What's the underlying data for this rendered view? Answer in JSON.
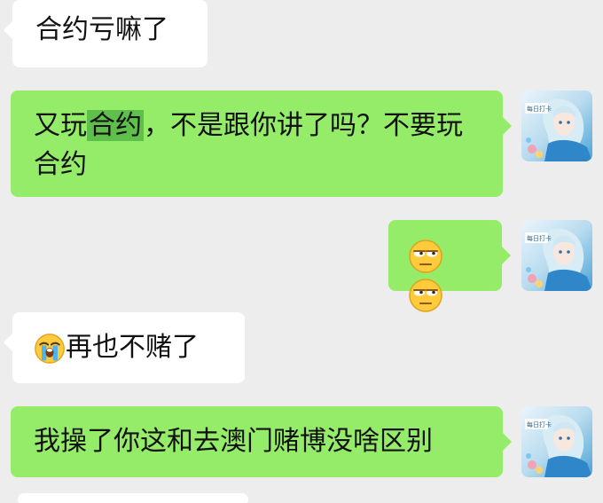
{
  "messages": [
    {
      "side": "in",
      "text": "合约亏嘛了"
    },
    {
      "side": "out",
      "text_pre": "又玩",
      "text_highlight": "合约",
      "text_post": "，不是跟你讲了吗？不要玩合约"
    },
    {
      "side": "out",
      "emoji": [
        "unamused-face-icon",
        "unamused-face-icon"
      ]
    },
    {
      "side": "in",
      "emoji": "loudly-crying-face-icon",
      "text": "再也不赌了"
    },
    {
      "side": "out",
      "text": "我操了你这和去澳门赌博没啥区别"
    }
  ],
  "colors": {
    "background": "#ededed",
    "incoming_bubble": "#ffffff",
    "outgoing_bubble": "#95ec69",
    "selection_highlight": "#5ec04a"
  },
  "avatar": {
    "icon": "anime-avatar-icon",
    "caption": "每日打卡"
  }
}
